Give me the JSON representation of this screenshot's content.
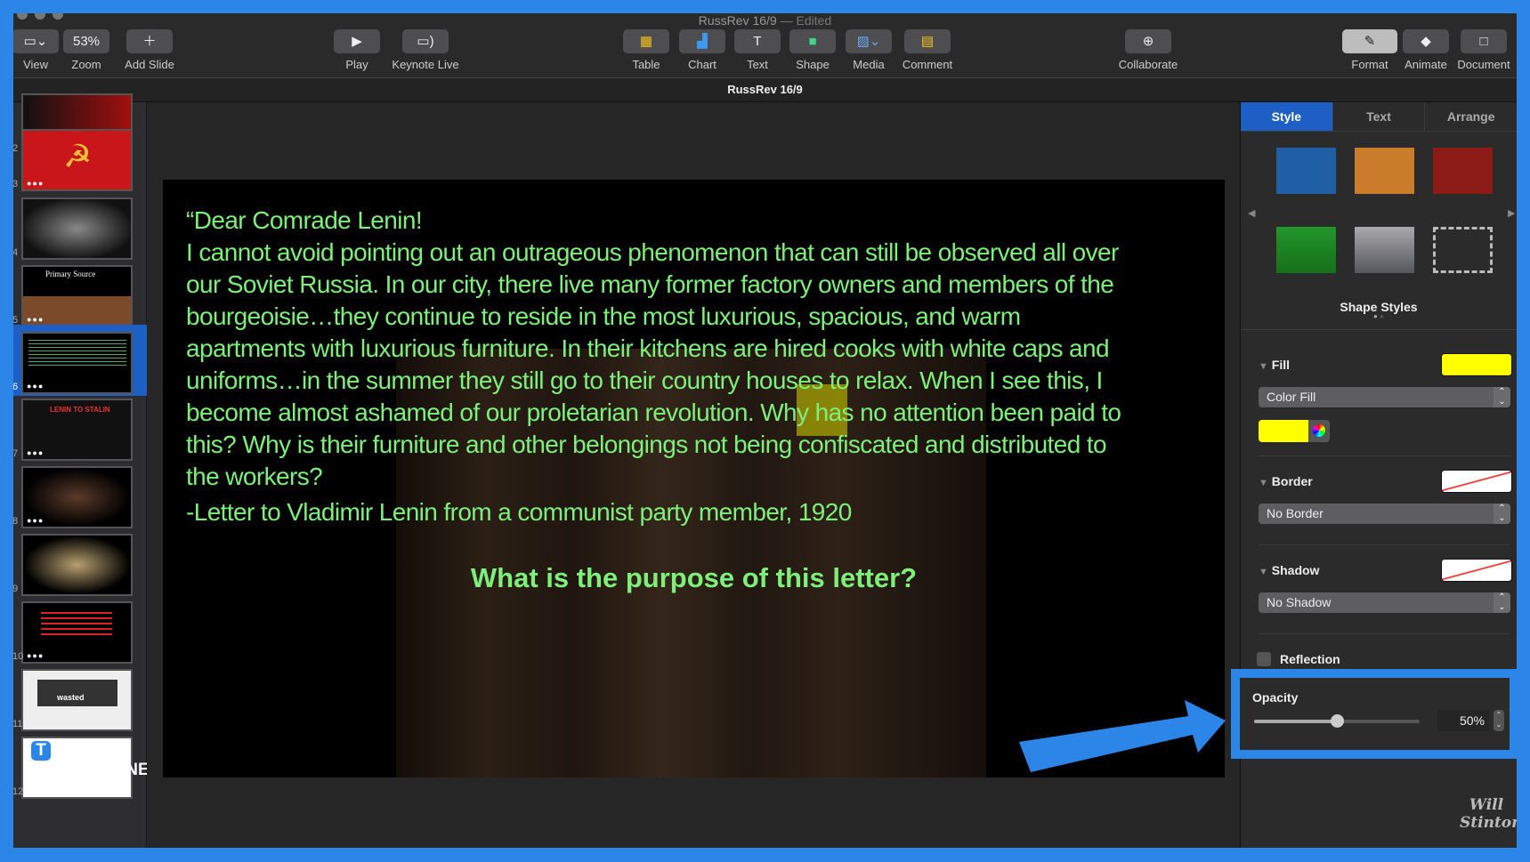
{
  "window": {
    "title": "RussRev 16/9",
    "title_suffix": "— Edited",
    "document_tab": "RussRev 16/9"
  },
  "toolbar": {
    "view": "View",
    "zoom_value": "53%",
    "zoom": "Zoom",
    "add_slide": "Add Slide",
    "play": "Play",
    "keynote_live": "Keynote Live",
    "table": "Table",
    "chart": "Chart",
    "text": "Text",
    "shape": "Shape",
    "media": "Media",
    "comment": "Comment",
    "collaborate": "Collaborate",
    "format": "Format",
    "animate": "Animate",
    "document": "Document"
  },
  "navigator": {
    "slides": [
      {
        "n": "2"
      },
      {
        "n": "3"
      },
      {
        "n": "4"
      },
      {
        "n": "5",
        "caption": "Primary Source"
      },
      {
        "n": "6",
        "selected": true
      },
      {
        "n": "7",
        "caption": "LENIN TO STALIN"
      },
      {
        "n": "8"
      },
      {
        "n": "9"
      },
      {
        "n": "10"
      },
      {
        "n": "11",
        "caption": "wasted"
      },
      {
        "n": "12"
      }
    ]
  },
  "slide": {
    "lines": [
      "“Dear Comrade Lenin!",
      "I cannot avoid pointing out an outrageous phenomenon that can still be observed all over",
      "our Soviet Russia. In our city, there live many former factory owners and members of the",
      "bourgeoisie…they continue to reside in the most luxurious, spacious, and warm",
      "apartments with luxurious furniture. In their kitchens are hired cooks with white caps and",
      "uniforms…in the summer they still go to their country houses to relax. When I see this, I",
      "become almost ashamed of our proletarian revolution. Why has no attention been paid to",
      "this? Why is their furniture and other belongings not being confiscated and distributed to",
      "the workers?"
    ],
    "signature": "-Letter to Vladimir Lenin from a communist party member, 1920",
    "question": "What is the purpose of this letter?",
    "text_color": "#7ef07a",
    "highlight_color": "#c8c800"
  },
  "inspector": {
    "tabs": [
      "Style",
      "Text",
      "Arrange"
    ],
    "active_tab": "Style",
    "shape_styles_label": "Shape Styles",
    "swatches": [
      "#1f5fa6",
      "#c97d2a",
      "#8c1a17",
      "#1e8a1e",
      "#8a8a8e",
      "#2b2b2c"
    ],
    "fill": {
      "label": "Fill",
      "type": "Color Fill",
      "color": "#ffff00"
    },
    "border": {
      "label": "Border",
      "type": "No Border"
    },
    "shadow": {
      "label": "Shadow",
      "type": "No Shadow"
    },
    "reflection": {
      "label": "Reflection",
      "checked": false
    },
    "opacity": {
      "label": "Opacity",
      "value_text": "50%",
      "value": 50
    }
  },
  "watermark": {
    "brand": "TEMPLATE.NET",
    "signature": "Will Stinton"
  },
  "accent": "#2b86e8"
}
